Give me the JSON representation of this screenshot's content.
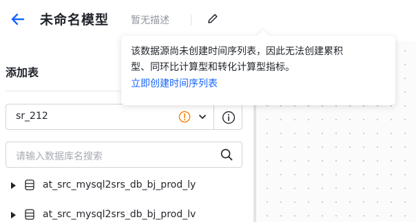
{
  "header": {
    "back_icon": "arrow-left-icon",
    "title": "未命名模型",
    "description": "暂无描述",
    "edit_icon": "pencil-icon",
    "accent_color": "#1664ff"
  },
  "panel": {
    "title": "添加表",
    "datasource": {
      "value": "sr_212",
      "warning_icon": "warning-circle-icon",
      "warning_color": "#ff7d00",
      "dropdown_icon": "chevron-down-icon",
      "info_icon": "info-circle-icon"
    },
    "search": {
      "placeholder": "请输入数据库名搜索",
      "icon": "search-icon"
    },
    "databases": [
      {
        "label": "at_src_mysql2srs_db_bj_prod_ly",
        "icon": "database-icon"
      },
      {
        "label": "at_src_mysql2srs_db_bj_prod_lv",
        "icon": "database-icon"
      }
    ]
  },
  "tooltip": {
    "line1": "该数据源尚未创建时间序列表，因此无法创建累积",
    "line2": "型、同环比计算型和转化计算型指标。",
    "link": "立即创建时间序列表"
  }
}
